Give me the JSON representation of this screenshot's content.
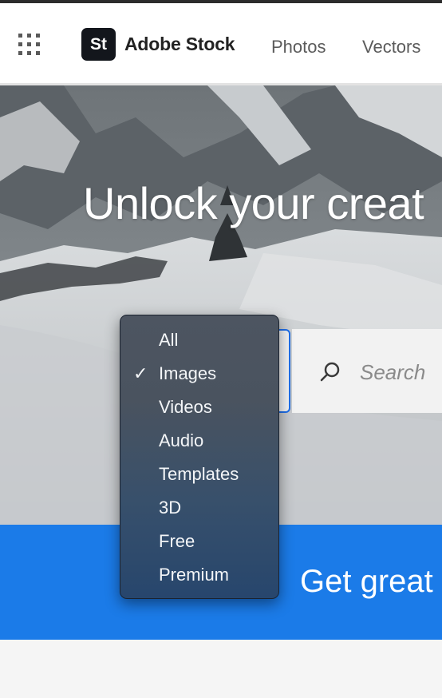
{
  "header": {
    "logo_badge": "St",
    "logo_text": "Adobe Stock",
    "nav": [
      "Photos",
      "Vectors"
    ]
  },
  "hero": {
    "title": "Unlock your creat",
    "search_placeholder": "Search"
  },
  "dropdown": {
    "selected": "Images",
    "check_glyph": "✓",
    "options": [
      "All",
      "Images",
      "Videos",
      "Audio",
      "Templates",
      "3D",
      "Free",
      "Premium"
    ]
  },
  "banner": {
    "text": "Get great v"
  },
  "colors": {
    "accent_blue": "#1b7be8",
    "focus_ring": "#1f6feb"
  }
}
